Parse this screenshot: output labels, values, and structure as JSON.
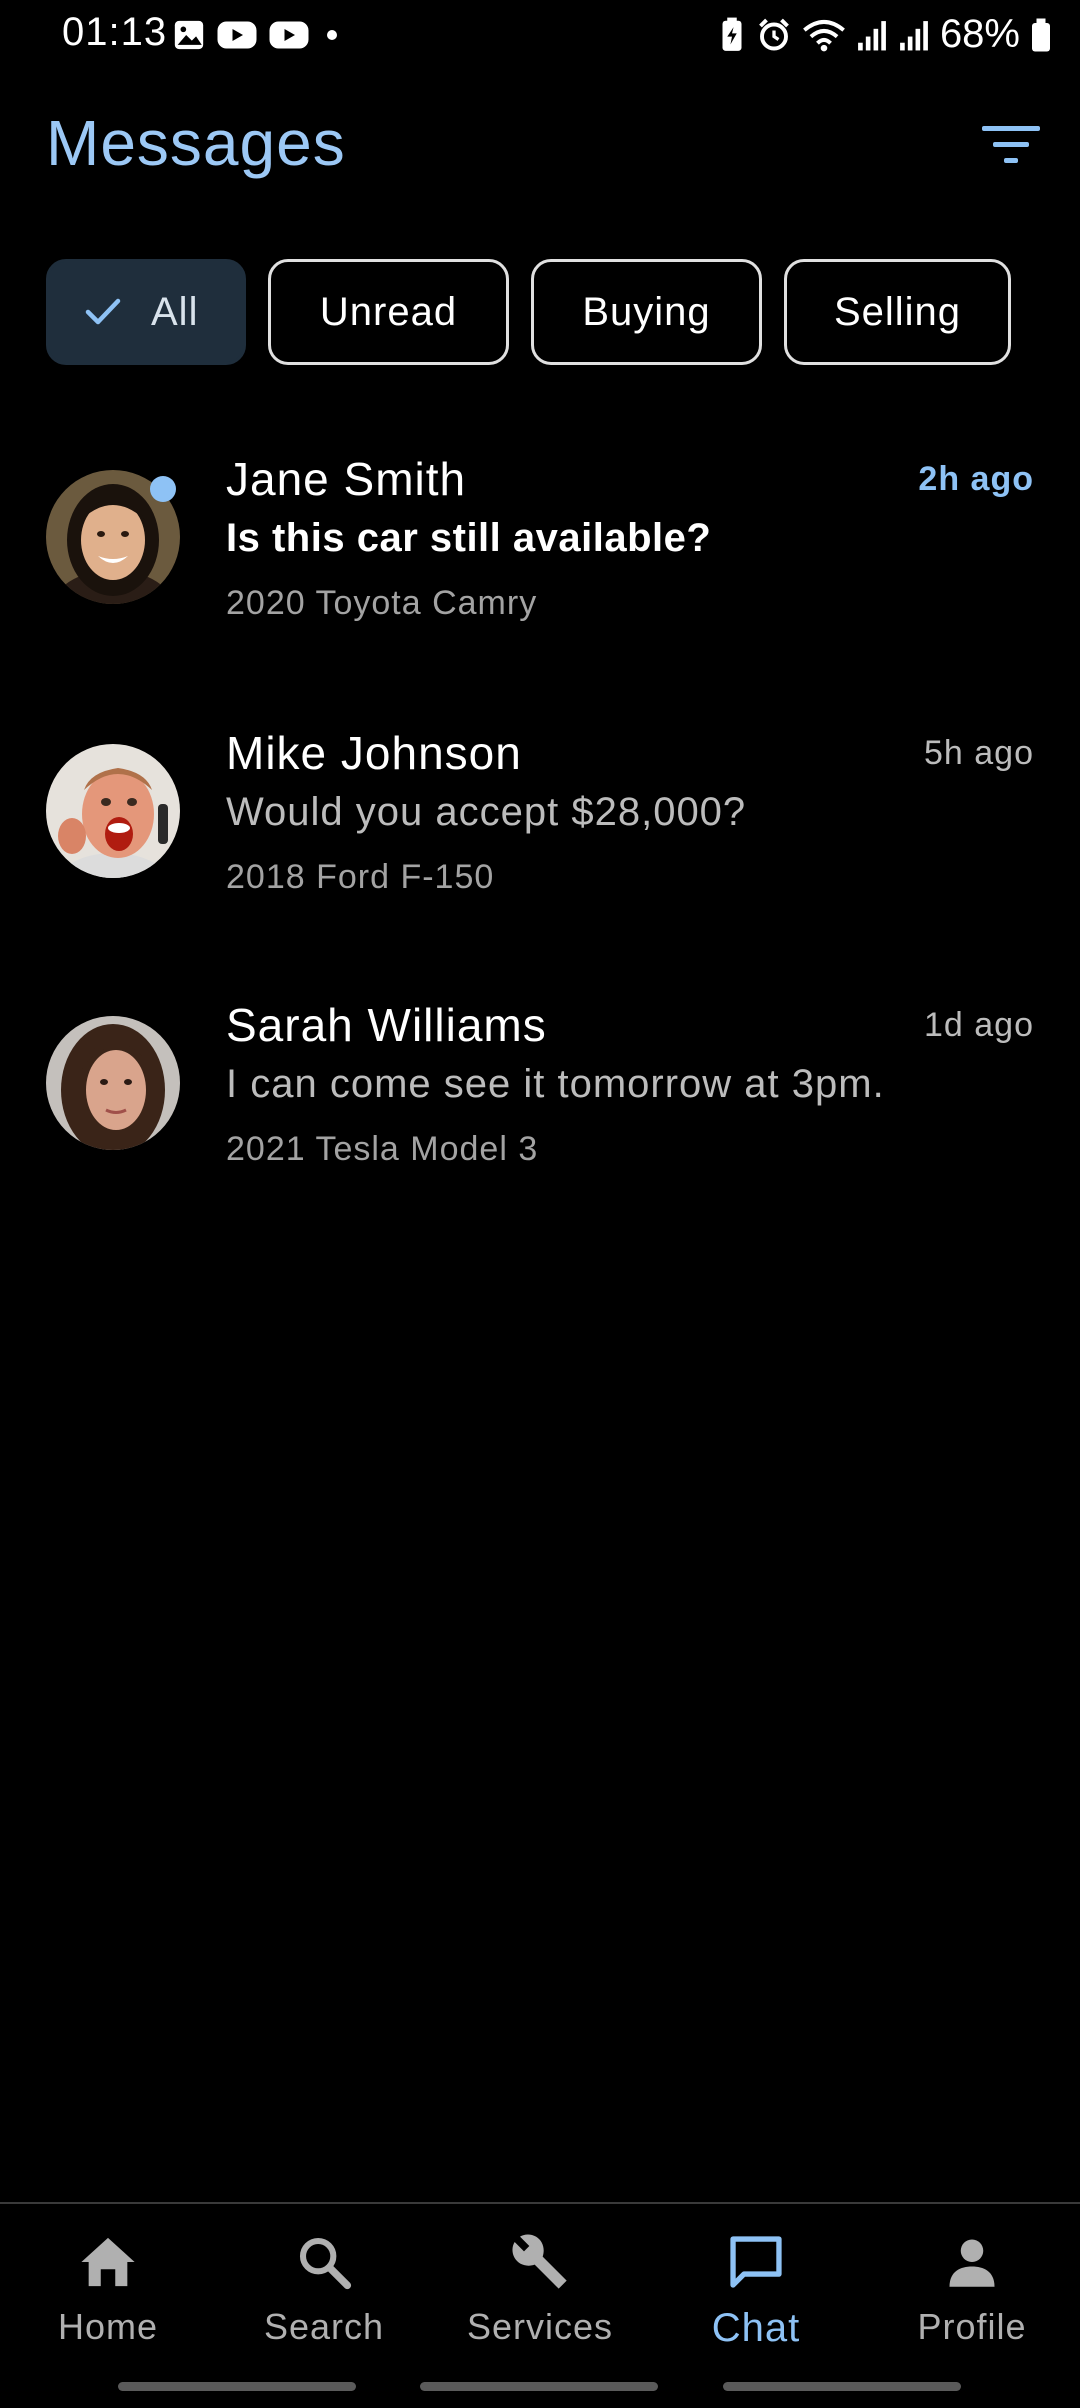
{
  "status_bar": {
    "time": "01:13",
    "battery": "68%",
    "left_icons": [
      "gallery-icon",
      "youtube-icon",
      "youtube-icon",
      "dot-icon"
    ],
    "right_icons": [
      "battery-saver-icon",
      "alarm-icon",
      "wifi-icon",
      "signal-icon",
      "signal-icon",
      "battery-icon"
    ]
  },
  "header": {
    "title": "Messages",
    "filter_icon": "filter-icon"
  },
  "filters": {
    "chips": [
      {
        "label": "All",
        "selected": true
      },
      {
        "label": "Unread",
        "selected": false
      },
      {
        "label": "Buying",
        "selected": false
      },
      {
        "label": "Selling",
        "selected": false
      }
    ]
  },
  "conversations": [
    {
      "name": "Jane Smith",
      "message": "Is this car still available?",
      "vehicle": "2020 Toyota Camry",
      "time": "2h ago",
      "unread": true
    },
    {
      "name": "Mike Johnson",
      "message": "Would you accept $28,000?",
      "vehicle": "2018 Ford F-150",
      "time": "5h ago",
      "unread": false
    },
    {
      "name": "Sarah Williams",
      "message": "I can come see it tomorrow at 3pm.",
      "vehicle": "2021 Tesla Model 3",
      "time": "1d ago",
      "unread": false
    }
  ],
  "bottom_nav": {
    "items": [
      {
        "label": "Home",
        "icon": "home-icon",
        "active": false
      },
      {
        "label": "Search",
        "icon": "search-icon",
        "active": false
      },
      {
        "label": "Services",
        "icon": "wrench-icon",
        "active": false
      },
      {
        "label": "Chat",
        "icon": "chat-icon",
        "active": true
      },
      {
        "label": "Profile",
        "icon": "person-icon",
        "active": false
      }
    ]
  },
  "colors": {
    "accent": "#8ec2f5",
    "title": "#9cc8f5",
    "selected_chip_bg": "#1f2e3c",
    "background": "#000000"
  }
}
